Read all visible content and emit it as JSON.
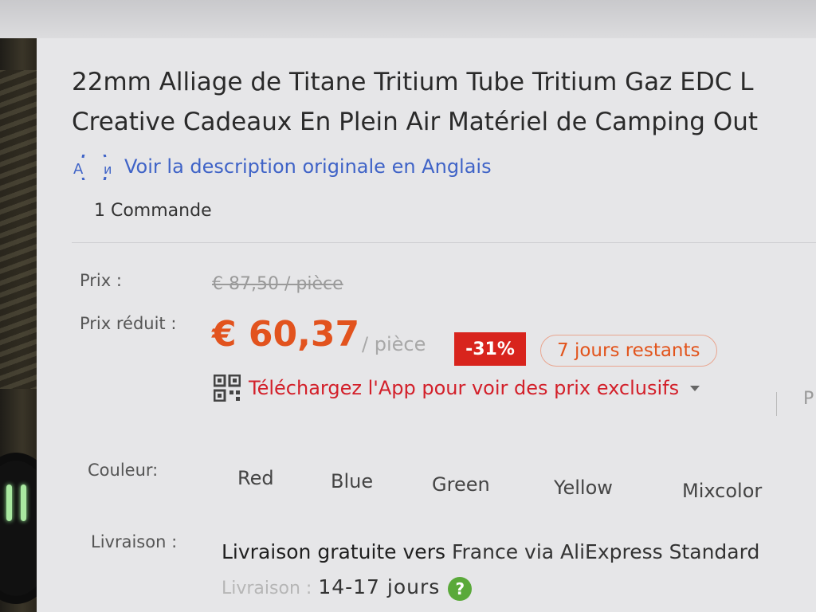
{
  "product": {
    "title_line1": "22mm Alliage de Titane Tritium Tube Tritium Gaz EDC L",
    "title_line2": "Creative Cadeaux En Plein Air Matériel de Camping Out",
    "translate_link": "Voir la description originale en Anglais",
    "orders": "1 Commande"
  },
  "pricing": {
    "price_label": "Prix :",
    "original_price": "€ 87,50 / pièce",
    "reduced_label": "Prix réduit :",
    "reduced_price": "€ 60,37",
    "per_unit": "/ pièce",
    "discount": "-31%",
    "days_left": "7 jours restants",
    "app_promo": "Téléchargez l'App pour voir des prix exclusifs",
    "app_more": "P"
  },
  "color": {
    "label": "Couleur:",
    "options": [
      "Red",
      "Blue",
      "Green",
      "Yellow",
      "Mixcolor"
    ]
  },
  "shipping": {
    "label": "Livraison :",
    "free_text": "Livraison gratuite vers",
    "destination": "France via AliExpress Standard",
    "delivery_label": "Livraison :",
    "delivery_time": "14-17 jours"
  },
  "colors": {
    "price_accent": "#e2531e",
    "badge": "#d8241d",
    "link": "#3f63c7",
    "promo": "#d3202a"
  },
  "icons": {
    "translate": "translate-icon",
    "qr": "qr-code-icon",
    "caret": "caret-down-icon",
    "help": "question-mark-icon"
  }
}
